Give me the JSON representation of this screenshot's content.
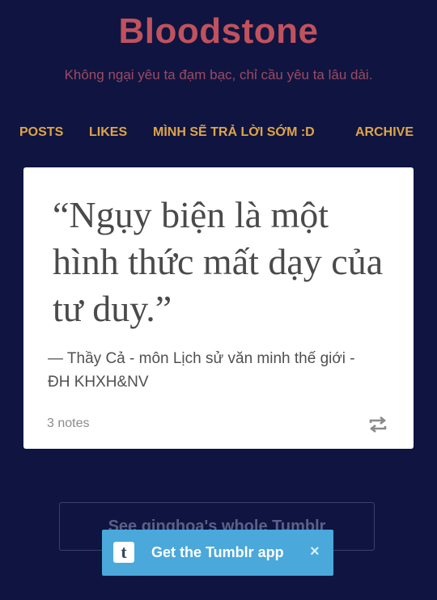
{
  "header": {
    "title": "Bloodstone",
    "description": "Không ngại yêu ta đạm bạc, chỉ cầu yêu ta lâu dài."
  },
  "nav": {
    "items": [
      {
        "label": "POSTS"
      },
      {
        "label": "LIKES"
      },
      {
        "label": "MÌNH SẼ TRẢ LỜI SỚM :D"
      },
      {
        "label": "ARCHIVE"
      }
    ]
  },
  "post": {
    "quote": "“Ngụy biện là một hình thức mất dạy của tư duy.”",
    "source": "— Thầy Cả - môn Lịch sử văn minh thế giới - ĐH KHXH&NV",
    "notes": "3 notes",
    "reblog_icon": "reblog-icon"
  },
  "footer": {
    "see_whole_tumblr": "See ginghoa's whole Tumblr"
  },
  "app_banner": {
    "logo": "t",
    "label": "Get the Tumblr app",
    "close": "×"
  },
  "colors": {
    "background": "#0f1540",
    "title": "#c0525e",
    "nav": "#e0a447",
    "banner": "#4aa8db"
  }
}
